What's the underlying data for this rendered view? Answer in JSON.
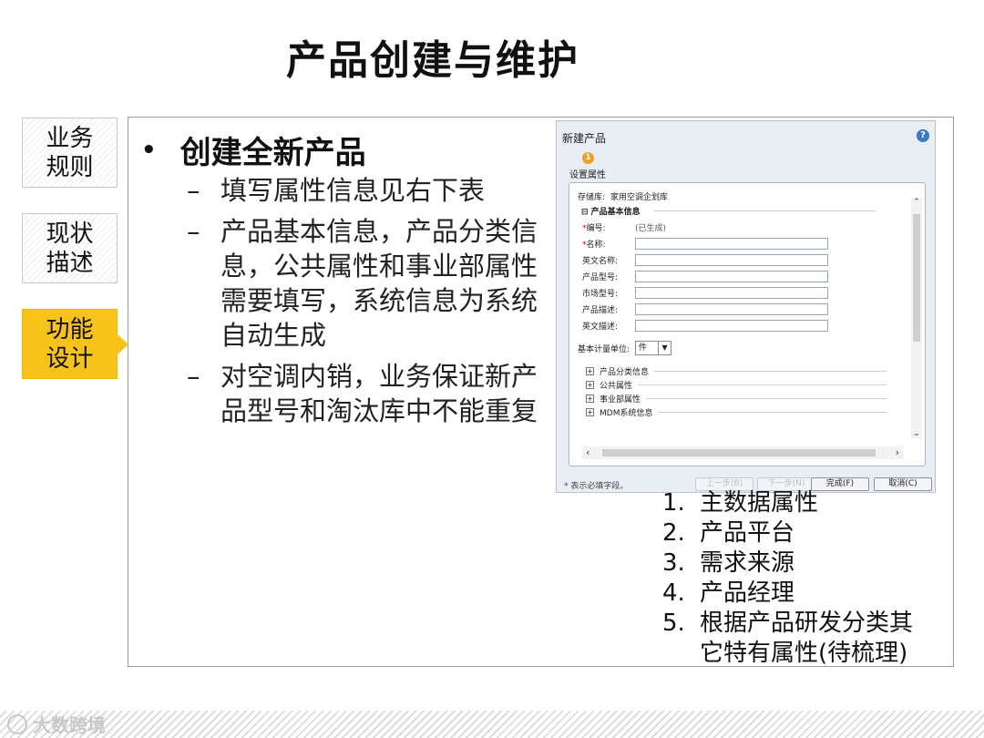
{
  "title": "产品创建与维护",
  "side_tabs": [
    {
      "line1": "业务",
      "line2": "规则"
    },
    {
      "line1": "现状",
      "line2": "描述"
    },
    {
      "line1": "功能",
      "line2": "设计"
    }
  ],
  "colors": {
    "active_tab": "#f7c21a",
    "frame_border": "#9a9a9a"
  },
  "main_bullet": "创建全新产品",
  "sub_bullets": [
    "填写属性信息见右下表",
    "产品基本信息，产品分类信息，公共属性和事业部属性需要填写，系统信息为系统自动生成",
    "对空调内销，业务保证新产品型号和淘汰库中不能重复"
  ],
  "dialog": {
    "title": "新建产品",
    "help": "?",
    "step_icon": "1",
    "step_label": "设置属性",
    "repo_label": "存储库:",
    "repo_value": "家用空调企划库",
    "group_header": "⊟ 产品基本信息",
    "fields": [
      {
        "label": "编号:",
        "required": "*",
        "value": "(已生成)"
      },
      {
        "label": "名称:",
        "required": "*"
      },
      {
        "label": "英文名称:"
      },
      {
        "label": "产品型号:"
      },
      {
        "label": "市场型号:"
      },
      {
        "label": "产品描述:"
      },
      {
        "label": "英文描述:"
      }
    ],
    "unit_label": "基本计量单位:",
    "unit_value": "件",
    "collapsed_groups": [
      "产品分类信息",
      "公共属性",
      "事业部属性",
      "MDM系统信息"
    ],
    "footer_note": "* 表示必填字段。",
    "buttons": {
      "prev": "上一步(B)",
      "next": "下一步(N)",
      "finish": "完成(F)",
      "cancel": "取消(C)"
    }
  },
  "numbered_list": [
    {
      "num": "1.",
      "text": "主数据属性"
    },
    {
      "num": "2.",
      "text": "产品平台"
    },
    {
      "num": "3.",
      "text": "需求来源"
    },
    {
      "num": "4.",
      "text": "产品经理"
    },
    {
      "num": "5.",
      "text": "根据产品研发分类其它特有属性(待梳理)"
    }
  ],
  "watermark": "大数跨境"
}
